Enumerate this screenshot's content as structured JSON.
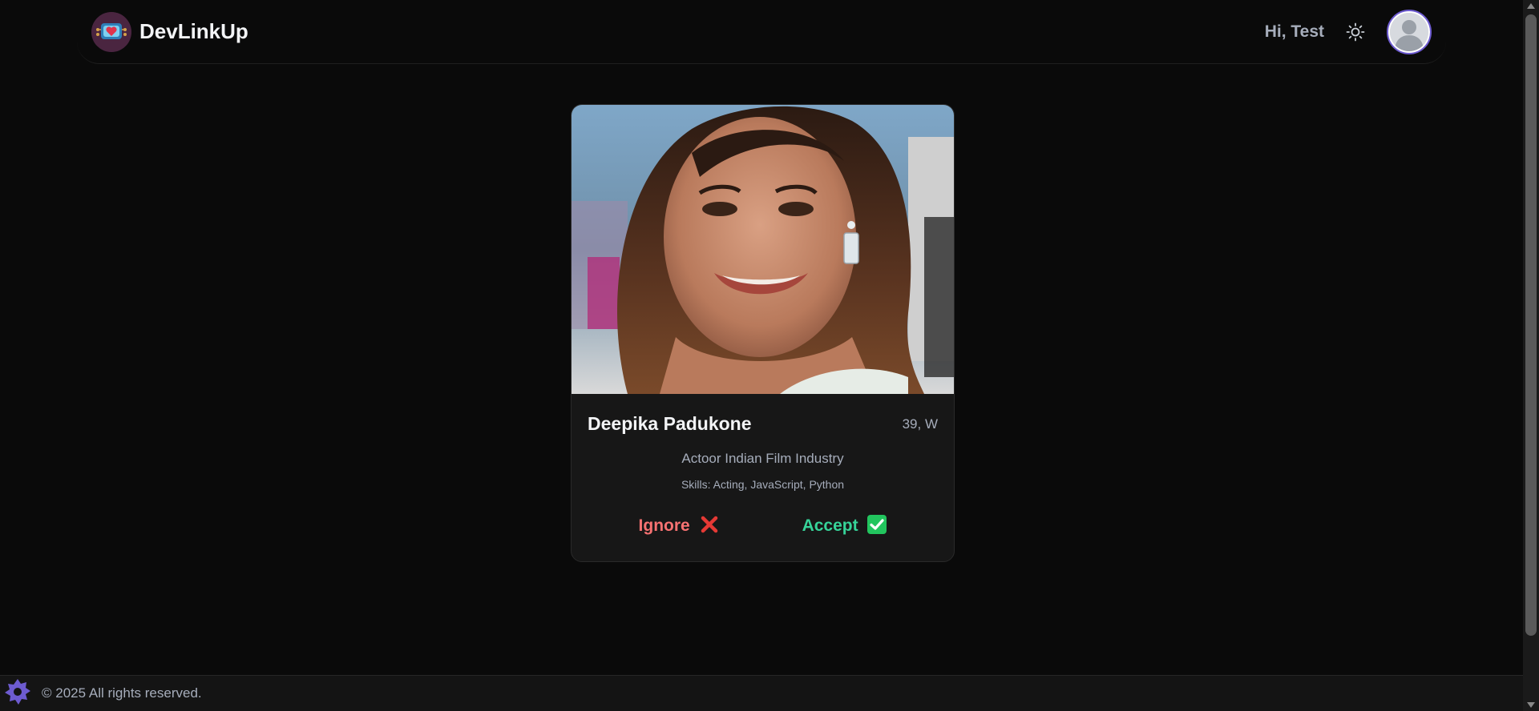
{
  "navbar": {
    "brand_name": "DevLinkUp",
    "greeting": "Hi, Test",
    "theme_icon": "sun-icon",
    "avatar_icon": "user-avatar-icon"
  },
  "card": {
    "name": "Deepika Padukone",
    "age_gender": "39, W",
    "about": "Actoor Indian Film Industry",
    "skills": "Skills: Acting, JavaScript, Python",
    "ignore_label": "Ignore",
    "accept_label": "Accept"
  },
  "footer": {
    "text": "© 2025 All rights reserved.",
    "icon": "puzzle-icon"
  },
  "colors": {
    "background": "#0a0a0a",
    "card": "#171717",
    "ignore": "#f87272",
    "accept": "#36d399",
    "accent": "#6d5bd0"
  }
}
